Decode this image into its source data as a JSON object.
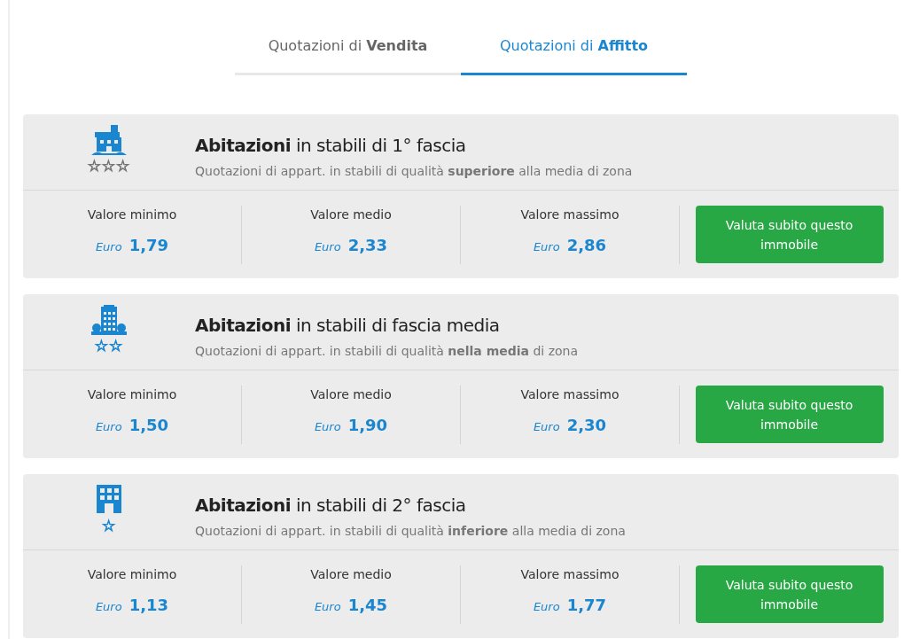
{
  "tabs": [
    {
      "label": "Quotazioni di **Vendita**",
      "selected": false
    },
    {
      "label": "Quotazioni di **Affitto**",
      "selected": true
    }
  ],
  "cards": [
    {
      "kind": "villa",
      "rating": "☆☆☆",
      "color": "#777777",
      "title": "**Abitazioni** in stabili di 1° fascia",
      "subtitle": "Quotazioni di appart. in stabili di qualità **superiore** alla media di zona",
      "values": [
        {
          "label": "Valore minimo",
          "currency": "Euro",
          "amount": "1,79"
        },
        {
          "label": "Valore medio",
          "currency": "Euro",
          "amount": "2,33"
        },
        {
          "label": "Valore massimo",
          "currency": "Euro",
          "amount": "2,86"
        }
      ],
      "button": "Valuta subito questo immobile"
    },
    {
      "kind": "tower",
      "rating": "☆☆",
      "color": "#1a86d0",
      "title": "**Abitazioni** in stabili di fascia media",
      "subtitle": "Quotazioni di appart. in stabili di qualità **nella media** di zona",
      "values": [
        {
          "label": "Valore minimo",
          "currency": "Euro",
          "amount": "1,50"
        },
        {
          "label": "Valore medio",
          "currency": "Euro",
          "amount": "1,90"
        },
        {
          "label": "Valore massimo",
          "currency": "Euro",
          "amount": "2,30"
        }
      ],
      "button": "Valuta subito questo immobile"
    },
    {
      "kind": "block",
      "rating": "☆",
      "color": "#1a86d0",
      "title": "**Abitazioni** in stabili di 2° fascia",
      "subtitle": "Quotazioni di appart. in stabili di qualità **inferiore** alla media di zona",
      "values": [
        {
          "label": "Valore minimo",
          "currency": "Euro",
          "amount": "1,13"
        },
        {
          "label": "Valore medio",
          "currency": "Euro",
          "amount": "1,45"
        },
        {
          "label": "Valore massimo",
          "currency": "Euro",
          "amount": "1,77"
        }
      ],
      "button": "Valuta subito questo immobile"
    }
  ]
}
